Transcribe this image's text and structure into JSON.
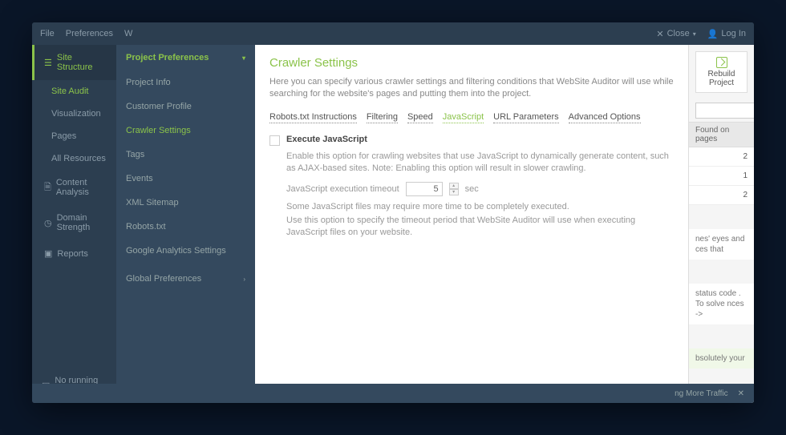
{
  "topbar": {
    "file": "File",
    "preferences": "Preferences",
    "w": "W",
    "close": "Close",
    "login": "Log In"
  },
  "sidebar": {
    "site_structure": "Site Structure",
    "site_audit": "Site Audit",
    "visualization": "Visualization",
    "pages": "Pages",
    "all_resources": "All Resources",
    "content_analysis": "Content Analysis",
    "domain_strength": "Domain Strength",
    "reports": "Reports",
    "no_running_tasks": "No running tasks"
  },
  "prefs": {
    "header": "Project Preferences",
    "project_info": "Project Info",
    "customer_profile": "Customer Profile",
    "crawler_settings": "Crawler Settings",
    "tags": "Tags",
    "events": "Events",
    "xml_sitemap": "XML Sitemap",
    "robots": "Robots.txt",
    "ga": "Google Analytics Settings",
    "global": "Global Preferences"
  },
  "content": {
    "title": "Crawler Settings",
    "desc": "Here you can specify various crawler settings and filtering conditions that WebSite Auditor will use while searching for the website's pages and putting them into the project.",
    "tabs": {
      "robots": "Robots.txt Instructions",
      "filtering": "Filtering",
      "speed": "Speed",
      "javascript": "JavaScript",
      "url_params": "URL Parameters",
      "advanced": "Advanced Options"
    },
    "execute_js": "Execute JavaScript",
    "execute_js_help": "Enable this option for crawling websites that use JavaScript to dynamically generate content, such as AJAX-based sites. Note: Enabling this option will result in slower crawling.",
    "timeout_label": "JavaScript execution timeout",
    "timeout_value": "5",
    "timeout_unit": "sec",
    "timeout_help1": "Some JavaScript files may require more time to be completely executed.",
    "timeout_help2": "Use this option to specify the timeout period that WebSite Auditor will use when executing JavaScript files on your website."
  },
  "right": {
    "rebuild": "Rebuild Project",
    "found_header": "Found on pages",
    "rows": [
      "2",
      "1",
      "2"
    ],
    "snippet1": "nes' eyes and ces that",
    "snippet2": "status code . To solve nces ->",
    "snippet3": "bsolutely your"
  },
  "footer": {
    "text": "ng More Traffic"
  }
}
